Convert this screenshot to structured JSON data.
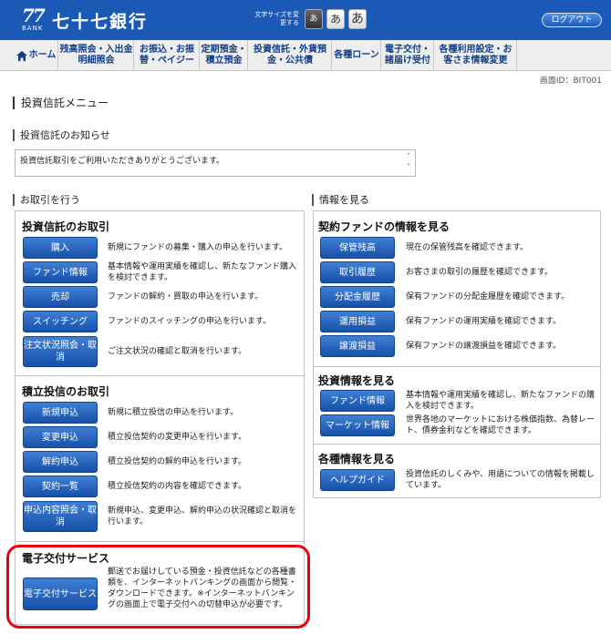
{
  "header": {
    "logo_number": "77",
    "logo_bank": "BANK",
    "bank_name": "七十七銀行",
    "font_size_label": "文字サイズを変更する",
    "font_buttons": [
      "あ",
      "あ",
      "あ"
    ],
    "logout_label": "ログアウト"
  },
  "nav": {
    "home": "ホーム",
    "items": [
      "残高照会・入出金明細照会",
      "お振込・お振替・ペイジー",
      "定期預金・積立預金",
      "投資信託・外貨預金・公共債",
      "各種ローン",
      "電子交付・諸届け受付",
      "各種利用設定・お客さま情報変更"
    ]
  },
  "screen_id": "画面ID：BIT001",
  "page_title": "投資信託メニュー",
  "notice": {
    "title": "投資信託のお知らせ",
    "text": "投資信託取引をご利用いただきありがとうございます。"
  },
  "left_section_title": "お取引を行う",
  "right_section_title": "情報を見る",
  "groups": {
    "trade": {
      "title": "投資信託のお取引",
      "items": [
        {
          "button": "購入",
          "desc": "新規にファンドの募集・購入の申込を行います。"
        },
        {
          "button": "ファンド情報",
          "desc": "基本情報や運用実績を確認し、新たなファンド購入を検討できます。"
        },
        {
          "button": "売却",
          "desc": "ファンドの解約・買取の申込を行います。"
        },
        {
          "button": "スイッチング",
          "desc": "ファンドのスイッチングの申込を行います。"
        },
        {
          "button": "注文状況照会・取消",
          "desc": "ご注文状況の確認と取消を行います。"
        }
      ]
    },
    "tsumitate": {
      "title": "積立投信のお取引",
      "items": [
        {
          "button": "新規申込",
          "desc": "新規に積立投信の申込を行います。"
        },
        {
          "button": "変更申込",
          "desc": "積立投信契約の変更申込を行います。"
        },
        {
          "button": "解約申込",
          "desc": "積立投信契約の解約申込を行います。"
        },
        {
          "button": "契約一覧",
          "desc": "積立投信契約の内容を確認できます。"
        },
        {
          "button": "申込内容照会・取消",
          "desc": "新規申込、変更申込、解約申込の状況確認と取消を行います。"
        }
      ]
    },
    "denshi": {
      "title": "電子交付サービス",
      "items": [
        {
          "button": "電子交付サービス",
          "desc": "郵送でお届けしている預金・投資信託などの各種書類を、インターネットバンキングの画面から閲覧・ダウンロードできます。※インターネットバンキングの画面上で電子交付への切替申込が必要です。"
        }
      ]
    },
    "contract_info": {
      "title": "契約ファンドの情報を見る",
      "items": [
        {
          "button": "保管残高",
          "desc": "現在の保管残高を確認できます。"
        },
        {
          "button": "取引履歴",
          "desc": "お客さまの取引の履歴を確認できます。"
        },
        {
          "button": "分配金履歴",
          "desc": "保有ファンドの分配金履歴を確認できます。"
        },
        {
          "button": "運用損益",
          "desc": "保有ファンドの運用実績を確認できます。"
        },
        {
          "button": "譲渡損益",
          "desc": "保有ファンドの譲渡損益を確認できます。"
        }
      ]
    },
    "invest_info": {
      "title": "投資情報を見る",
      "items": [
        {
          "button": "ファンド情報",
          "desc": "基本情報や運用実績を確認し、新たなファンドの購入を検討できます。"
        },
        {
          "button": "マーケット情報",
          "desc": "世界各地のマーケットにおける株価指数、為替レート、債券金利などを確認できます。"
        }
      ]
    },
    "various_info": {
      "title": "各種情報を見る",
      "items": [
        {
          "button": "ヘルプガイド",
          "desc": "投資信託のしくみや、用語についての情報を掲載しています。"
        }
      ]
    }
  },
  "colors": {
    "header_bg": "#1a59b5",
    "button_blue": "#1750a8",
    "highlight_red": "#e8000c"
  }
}
